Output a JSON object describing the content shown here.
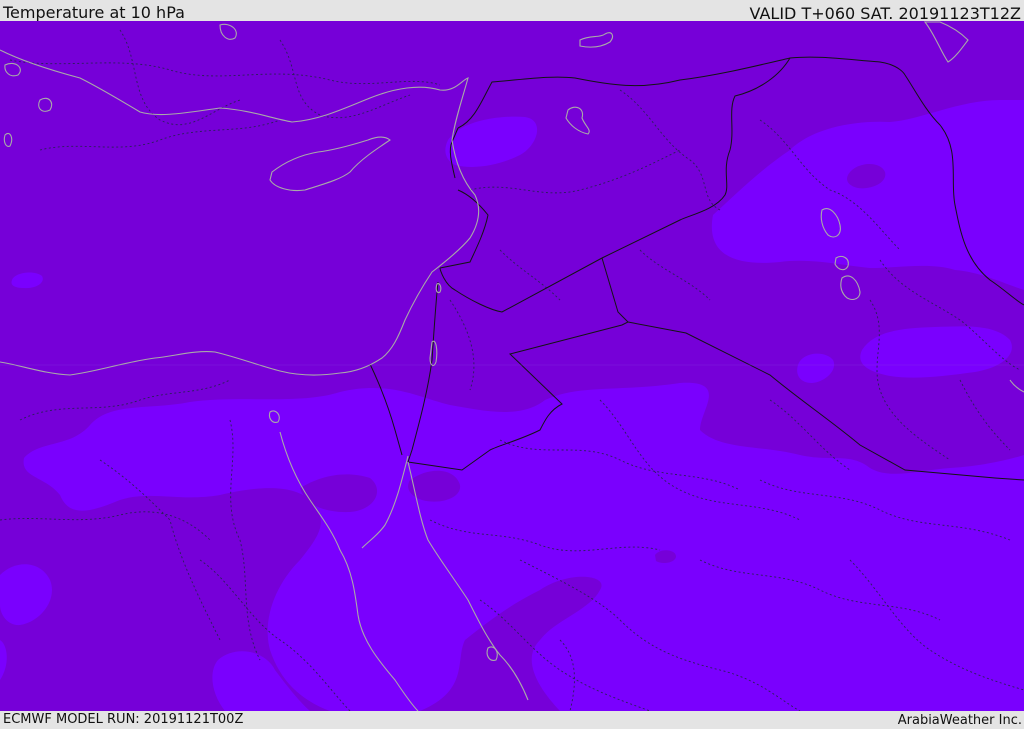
{
  "header": {
    "title": "Temperature at 10 hPa",
    "valid_time": "VALID T+060 SAT. 20191123T12Z"
  },
  "footer": {
    "model_run": "ECMWF MODEL RUN: 20191121T00Z",
    "credit": "ArabiaWeather Inc."
  },
  "map": {
    "field": "Temperature at 10 hPa",
    "colors": {
      "base_field": "#7600d8",
      "warmer_field": "#7a00fe",
      "coastline": "#a9a9a9",
      "border": "#141414",
      "province_line": "#2b1f5a"
    }
  }
}
